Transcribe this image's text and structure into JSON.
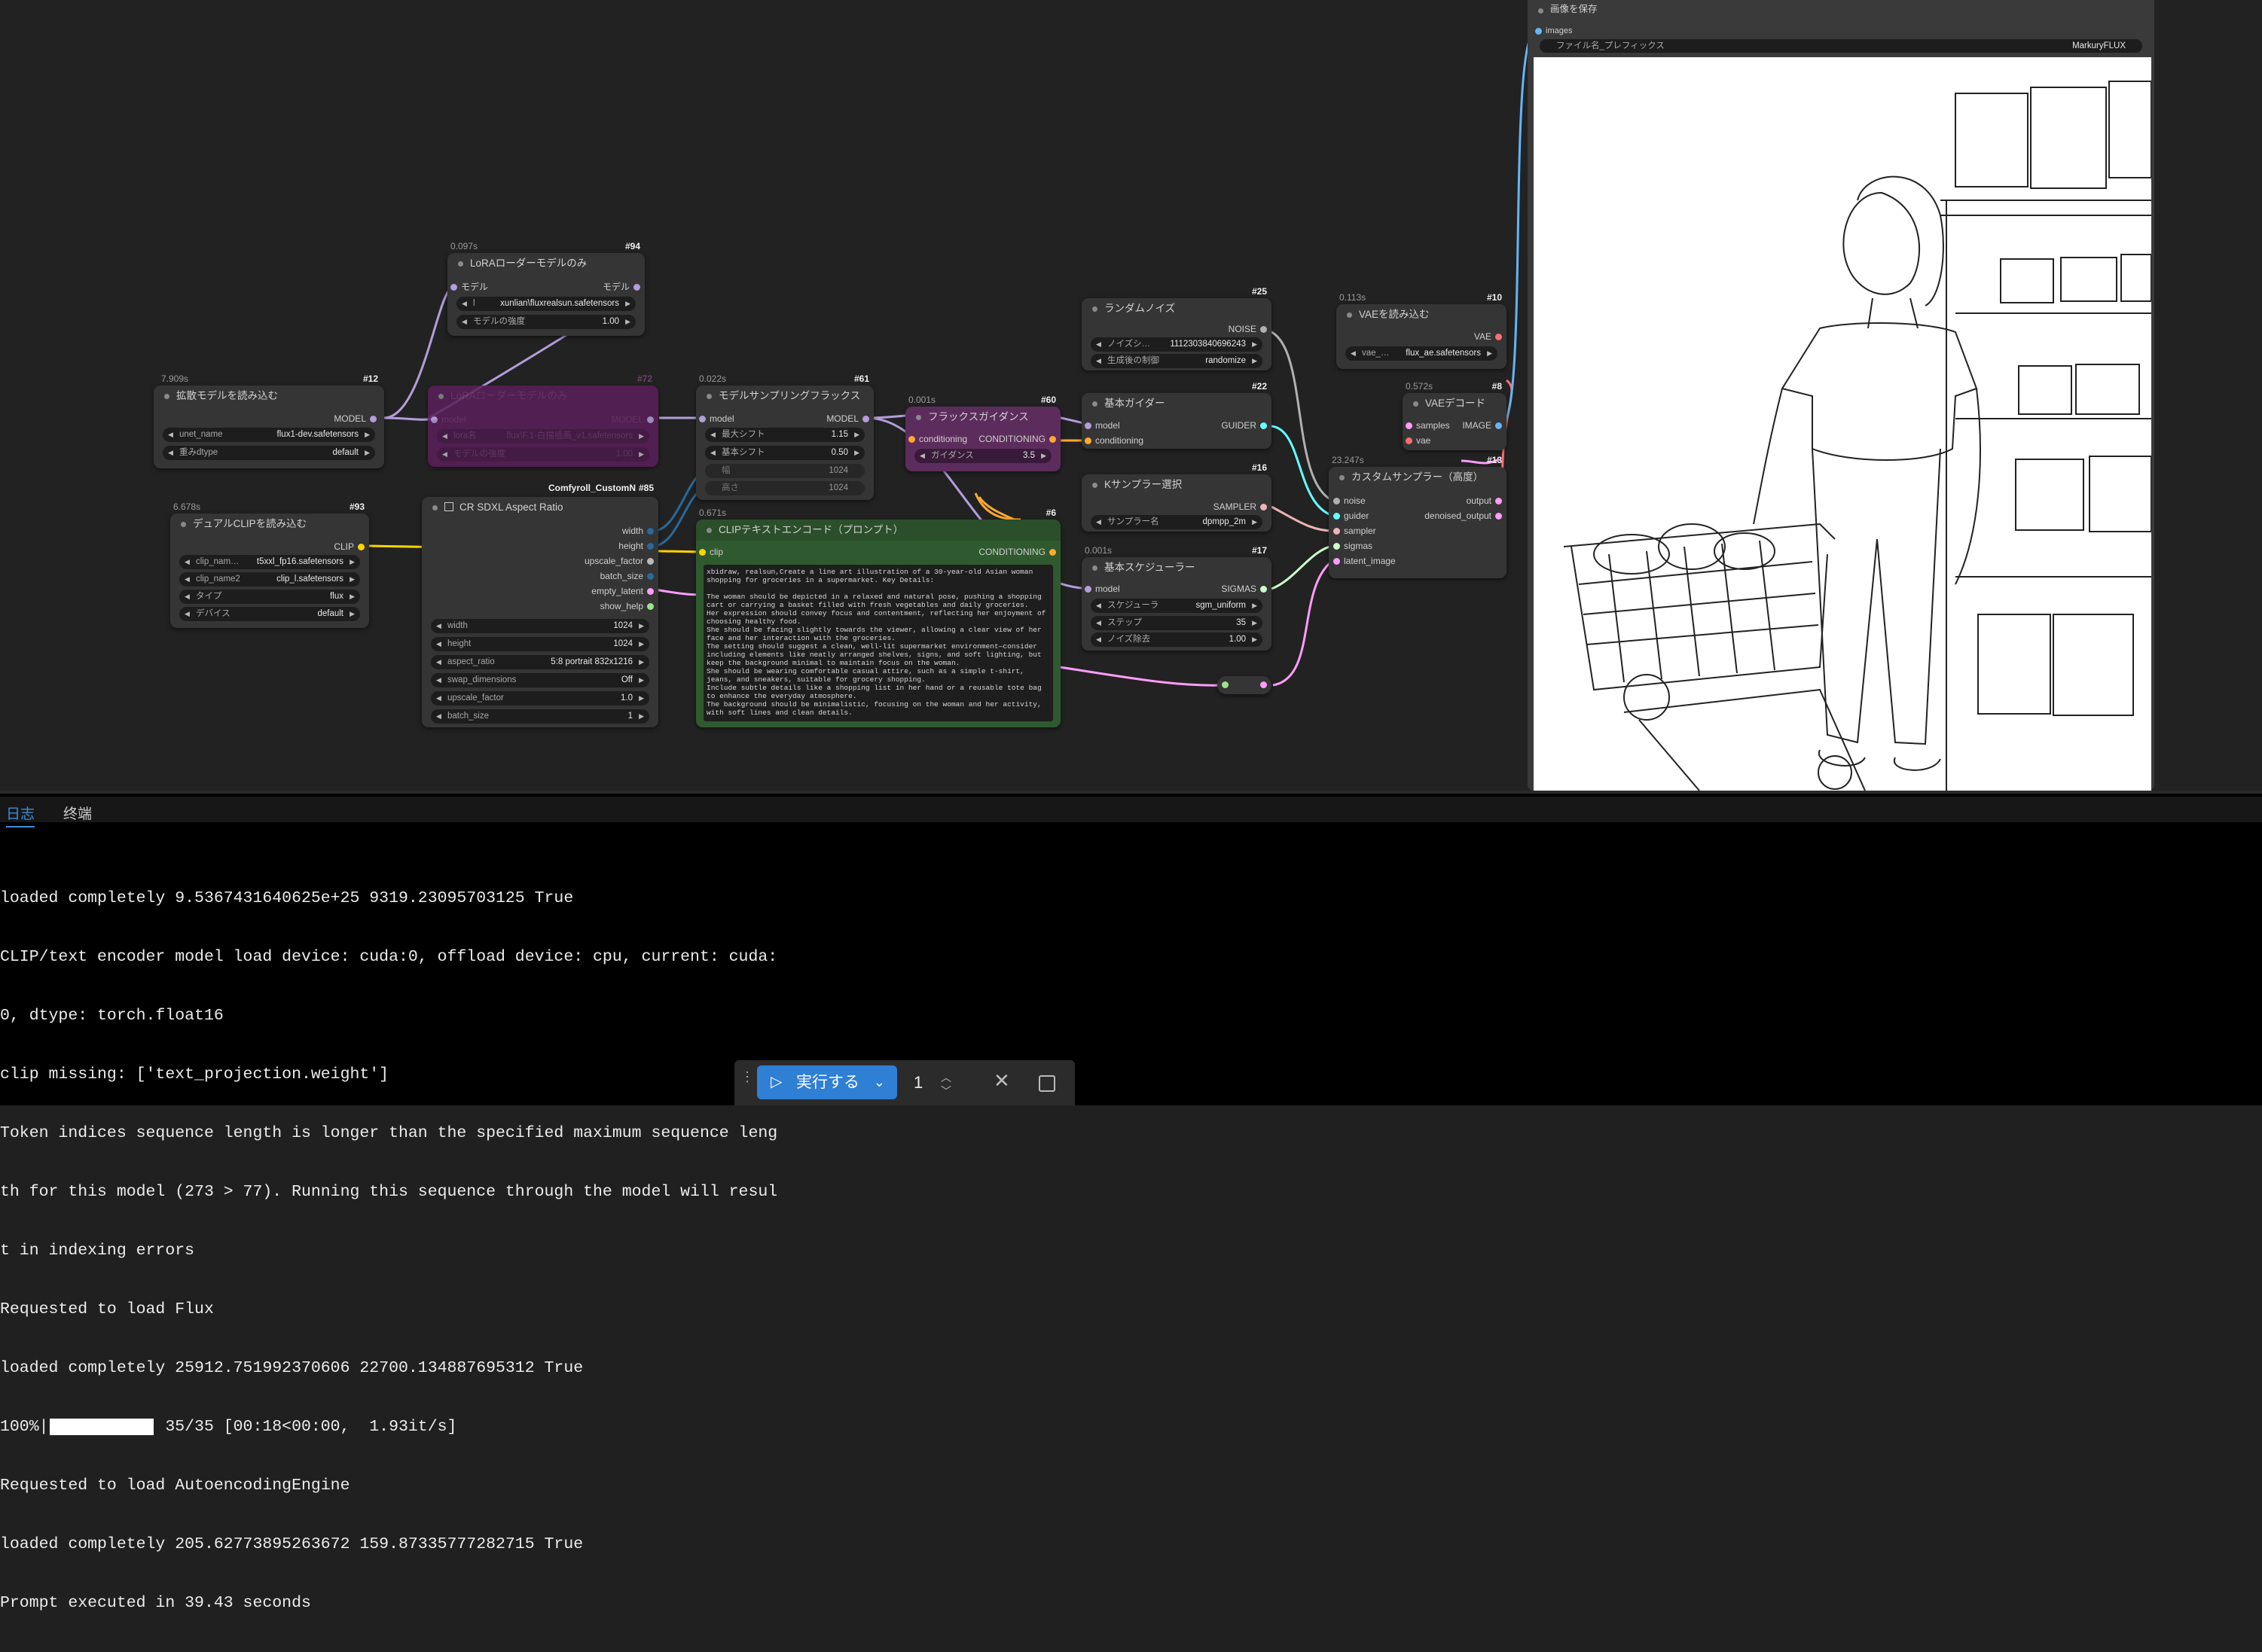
{
  "nodes": {
    "unet": {
      "id": "#12",
      "time": "7.909s",
      "title": "拡散モデルを読み込む",
      "output": "MODEL",
      "widgets": [
        {
          "label": "unet_name",
          "value": "flux1-dev.safetensors"
        },
        {
          "label": "重みdtype",
          "value": "default"
        }
      ]
    },
    "lora": {
      "id": "#94",
      "time": "0.097s",
      "title": "LoRAローダーモデルのみ",
      "input": "モデル",
      "output": "モデル",
      "widgets": [
        {
          "label": "l",
          "value": "xunlian\\fluxrealsun.safetensors"
        },
        {
          "label": "モデルの強度",
          "value": "1.00"
        }
      ]
    },
    "lora_bypassed": {
      "id": "#72",
      "title": "LoRAローダーモデルのみ",
      "input": "model",
      "output": "MODEL",
      "widgets": [
        {
          "label": "lora名",
          "value": "flux\\F.1-白描插画_v1.safetensors"
        },
        {
          "label": "モデルの強度",
          "value": "1.00"
        }
      ]
    },
    "dualclip": {
      "id": "#93",
      "time": "6.678s",
      "title": "デュアルCLIPを読み込む",
      "output": "CLIP",
      "widgets": [
        {
          "label": "clip_nam…",
          "value": "t5xxl_fp16.safetensors"
        },
        {
          "label": "clip_name2",
          "value": "clip_l.safetensors"
        },
        {
          "label": "タイプ",
          "value": "flux"
        },
        {
          "label": "デバイス",
          "value": "default"
        }
      ]
    },
    "aspect": {
      "id": "#85",
      "badge": "Comfyroll_CustomN",
      "title": "CR SDXL Aspect Ratio",
      "outputs": [
        "width",
        "height",
        "upscale_factor",
        "batch_size",
        "empty_latent",
        "show_help"
      ],
      "widgets": [
        {
          "label": "width",
          "value": "1024"
        },
        {
          "label": "height",
          "value": "1024"
        },
        {
          "label": "aspect_ratio",
          "value": "5:8 portrait 832x1216"
        },
        {
          "label": "swap_dimensions",
          "value": "Off"
        },
        {
          "label": "upscale_factor",
          "value": "1.0"
        },
        {
          "label": "batch_size",
          "value": "1"
        }
      ]
    },
    "modelsampling": {
      "id": "#61",
      "time": "0.022s",
      "title": "モデルサンプリングフラックス",
      "input": "model",
      "output": "MODEL",
      "widgets": [
        {
          "label": "最大シフト",
          "value": "1.15"
        },
        {
          "label": "基本シフト",
          "value": "0.50"
        },
        {
          "label": "幅",
          "value": "1024"
        },
        {
          "label": "高さ",
          "value": "1024"
        }
      ]
    },
    "clipenc": {
      "id": "#6",
      "time": "0.671s",
      "title": "CLIPテキストエンコード（プロンプト）",
      "input": "clip",
      "output": "CONDITIONING",
      "text": "xbidraw, realsun,Create a line art illustration of a 30-year-old Asian woman shopping for groceries in a supermarket. Key Details:\n\nThe woman should be depicted in a relaxed and natural pose, pushing a shopping cart or carrying a basket filled with fresh vegetables and daily groceries.\nHer expression should convey focus and contentment, reflecting her enjoyment of choosing healthy food.\nShe should be facing slightly towards the viewer, allowing a clear view of her face and her interaction with the groceries.\nThe setting should suggest a clean, well-lit supermarket environment—consider including elements like neatly arranged shelves, signs, and soft lighting, but keep the background minimal to maintain focus on the woman.\nShe should be wearing comfortable casual attire, such as a simple t-shirt, jeans, and sneakers, suitable for grocery shopping.\nInclude subtle details like a shopping list in her hand or a reusable tote bag to enhance the everyday atmosphere.\nThe background should be minimalistic, focusing on the woman and her activity, with soft lines and clean details."
    },
    "fluxguid": {
      "id": "#60",
      "time": "0.001s",
      "title": "フラックスガイダンス",
      "input": "conditioning",
      "output": "CONDITIONING",
      "widgets": [
        {
          "label": "ガイダンス",
          "value": "3.5"
        }
      ]
    },
    "noise": {
      "id": "#25",
      "title": "ランダムノイズ",
      "output": "NOISE",
      "widgets": [
        {
          "label": "ノイズシ…",
          "value": "1112303840696243"
        },
        {
          "label": "生成後の制御",
          "value": "randomize"
        }
      ]
    },
    "guider": {
      "id": "#22",
      "title": "基本ガイダー",
      "inputs": [
        "model",
        "conditioning"
      ],
      "output": "GUIDER"
    },
    "ksampler": {
      "id": "#16",
      "title": "Kサンプラー選択",
      "output": "SAMPLER",
      "widgets": [
        {
          "label": "サンプラー名",
          "value": "dpmpp_2m"
        }
      ]
    },
    "scheduler": {
      "id": "#17",
      "time": "0.001s",
      "title": "基本スケジューラー",
      "input": "model",
      "output": "SIGMAS",
      "widgets": [
        {
          "label": "スケジューラ",
          "value": "sgm_uniform"
        },
        {
          "label": "ステップ",
          "value": "35"
        },
        {
          "label": "ノイズ除去",
          "value": "1.00"
        }
      ]
    },
    "vaeload": {
      "id": "#10",
      "time": "0.113s",
      "title": "VAEを読み込む",
      "output": "VAE",
      "widgets": [
        {
          "label": "vae_…",
          "value": "flux_ae.safetensors"
        }
      ]
    },
    "vaedecode": {
      "id": "#8",
      "time": "0.572s",
      "title": "VAEデコード",
      "inputs": [
        "samples",
        "vae"
      ],
      "output": "IMAGE"
    },
    "customsampler": {
      "id": "#13",
      "time": "23.247s",
      "title": "カスタムサンプラー（高度）",
      "inputs": [
        "noise",
        "guider",
        "sampler",
        "sigmas",
        "latent_image"
      ],
      "outputs": [
        "output",
        "denoised_output"
      ]
    },
    "save": {
      "title": "画像を保存",
      "input": "images",
      "widgets": [
        {
          "label": "ファイル名_プレフィックス",
          "value": "MarkuryFLUX"
        }
      ]
    }
  },
  "panel": {
    "tabs": [
      {
        "label": "日志",
        "active": true
      },
      {
        "label": "终端",
        "active": false
      }
    ],
    "log_lines": [
      "loaded completely 9.5367431640625e+25 9319.23095703125 True",
      "CLIP/text encoder model load device: cuda:0, offload device: cpu, current: cuda:",
      "0, dtype: torch.float16",
      "clip missing: ['text_projection.weight']",
      "Token indices sequence length is longer than the specified maximum sequence leng",
      "th for this model (273 > 77). Running this sequence through the model will resul",
      "t in indexing errors",
      "Requested to load Flux",
      "loaded completely 25912.751992370606 22700.134887695312 True",
      "100%|          | 35/35 [00:18<00:00,  1.93it/s]",
      "Requested to load AutoencodingEngine",
      "loaded completely 205.62773895263672 159.87335777282715 True",
      "Prompt executed in 39.43 seconds"
    ]
  },
  "toolbar": {
    "run_label": "実行する",
    "batch_count": "1"
  },
  "colors": {
    "model": "#b39ddb",
    "clip": "#ffd500",
    "conditioning": "#ffa931",
    "latent": "#ff9cf9",
    "vae": "#ff6e6e",
    "image": "#64b5f6",
    "int": "#29699c",
    "noise": "#b0b0b0",
    "guider": "#66ffff",
    "sampler": "#ecb4b4",
    "sigmas": "#cdffcd",
    "accent": "#2f7fd4"
  }
}
